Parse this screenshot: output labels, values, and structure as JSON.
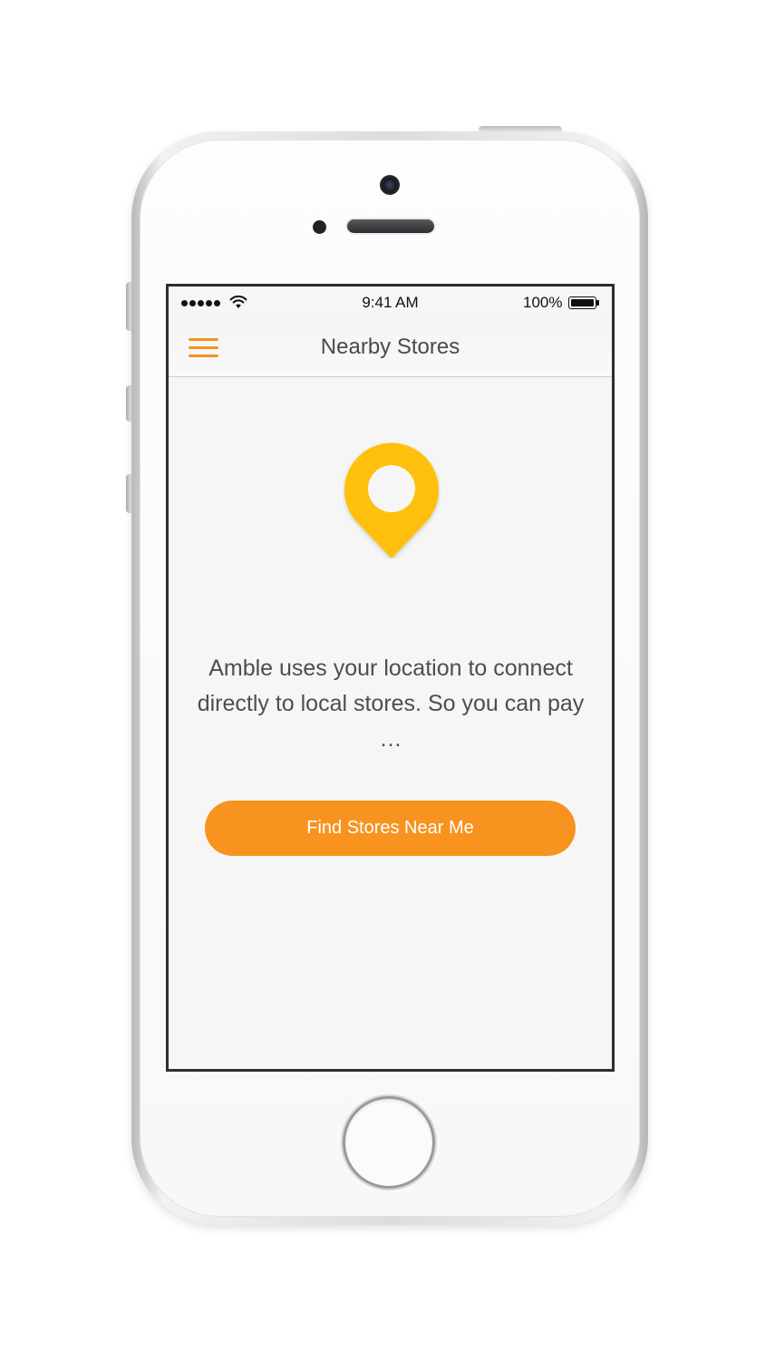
{
  "status_bar": {
    "time": "9:41 AM",
    "battery_percent": "100%",
    "signal_bars": 5,
    "wifi_icon": "wifi-icon",
    "battery_icon": "battery-icon"
  },
  "nav": {
    "title": "Nearby Stores",
    "menu_icon": "hamburger-menu-icon"
  },
  "hero": {
    "icon": "location-pin-icon",
    "icon_color": "#FFC00E"
  },
  "message": "Amble uses your location to connect directly to local stores. So you can pay …",
  "cta": {
    "label": "Find Stores Near Me",
    "color": "#F7931E"
  },
  "colors": {
    "accent": "#F7931E",
    "screen_background": "#F6F6F6",
    "title_text": "#4A4A4A"
  }
}
